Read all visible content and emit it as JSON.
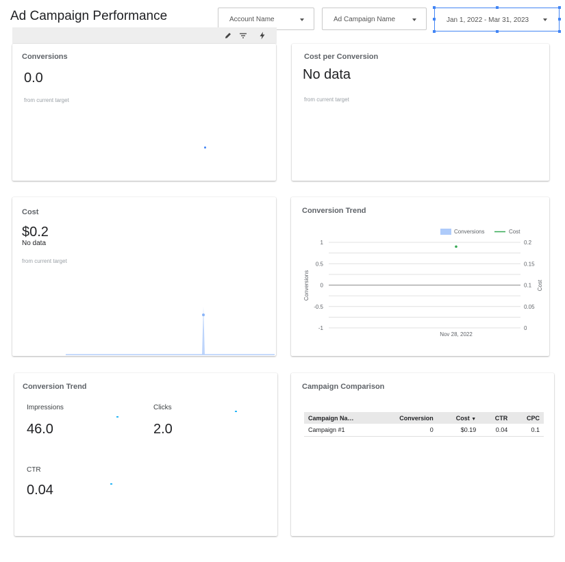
{
  "header": {
    "title": "Ad Campaign Performance",
    "filters": {
      "account": "Account Name",
      "campaign": "Ad Campaign Name",
      "date_range": "Jan 1, 2022 - Mar 31, 2023"
    }
  },
  "toolbar": {
    "icons": [
      "edit-icon",
      "filter-icon",
      "lightning-icon"
    ]
  },
  "scorecards": {
    "conversions": {
      "title": "Conversions",
      "value": "0.0",
      "note": "from current target"
    },
    "cost_per_conversion": {
      "title": "Cost per Conversion",
      "value": "No data",
      "note": "from current target"
    },
    "cost": {
      "title": "Cost",
      "value": "$0.2",
      "sub": "No data",
      "note": "from current target"
    }
  },
  "trend_chart": {
    "title": "Conversion Trend",
    "legend": {
      "conversions": "Conversions",
      "cost": "Cost"
    },
    "left_axis_label": "Conversions",
    "right_axis_label": "Cost",
    "left_ticks": [
      "1",
      "0.5",
      "0",
      "-0.5",
      "-1"
    ],
    "right_ticks": [
      "0.2",
      "0.15",
      "0.1",
      "0.05",
      "0"
    ],
    "x_label": "Nov 28, 2022"
  },
  "chart_data": {
    "type": "line",
    "x": [
      "Nov 28, 2022"
    ],
    "series": [
      {
        "name": "Conversions",
        "axis": "left",
        "values": [
          0
        ]
      },
      {
        "name": "Cost",
        "axis": "right",
        "values": [
          0.19
        ]
      }
    ],
    "ylim_left": [
      -1,
      1
    ],
    "ylim_right": [
      0,
      0.2
    ],
    "ylabel_left": "Conversions",
    "ylabel_right": "Cost",
    "legend": "top-right",
    "grid": true,
    "colors": {
      "Conversions": "#aecbfa",
      "Cost": "#34a853"
    }
  },
  "kpi_panel": {
    "title": "Conversion Trend",
    "impressions": {
      "label": "Impressions",
      "value": "46.0"
    },
    "clicks": {
      "label": "Clicks",
      "value": "2.0"
    },
    "ctr": {
      "label": "CTR",
      "value": "0.04"
    }
  },
  "comparison": {
    "title": "Campaign Comparison",
    "columns": [
      "Campaign Na…",
      "Conversion",
      "Cost",
      "CTR",
      "CPC"
    ],
    "rows": [
      [
        "Campaign #1",
        "0",
        "$0.19",
        "0.04",
        "0.1"
      ]
    ]
  },
  "colors": {
    "accent": "#4285f4",
    "series_blue": "#aecbfa",
    "series_green": "#34a853"
  }
}
